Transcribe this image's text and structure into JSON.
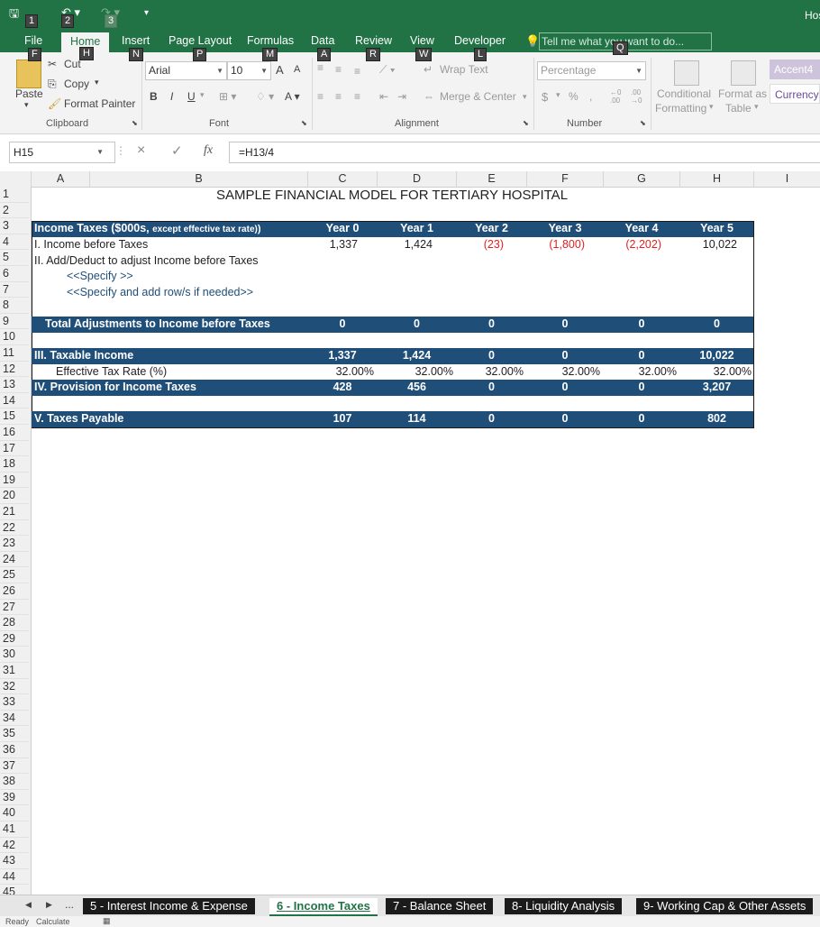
{
  "title_bar": {
    "app_title_partial": "Hos",
    "qa_keytips": [
      "1",
      "2",
      "3"
    ]
  },
  "menu": {
    "items": [
      {
        "label": "File",
        "keytip": "F"
      },
      {
        "label": "Home",
        "keytip": "H"
      },
      {
        "label": "Insert",
        "keytip": "N"
      },
      {
        "label": "Page Layout",
        "keytip": "P"
      },
      {
        "label": "Formulas",
        "keytip": "M"
      },
      {
        "label": "Data",
        "keytip": "A"
      },
      {
        "label": "Review",
        "keytip": "R"
      },
      {
        "label": "View",
        "keytip": "W"
      },
      {
        "label": "Developer",
        "keytip": "L"
      }
    ],
    "tell_me": "Tell me what you want to do...",
    "tell_me_keytip": "Q"
  },
  "ribbon": {
    "clipboard": {
      "paste": "Paste",
      "cut": "Cut",
      "copy": "Copy",
      "format_painter": "Format Painter",
      "label": "Clipboard"
    },
    "font": {
      "name": "Arial",
      "size": "10",
      "grow": "A",
      "shrink": "A",
      "bold": "B",
      "italic": "I",
      "underline": "U",
      "label": "Font"
    },
    "alignment": {
      "wrap_text": "Wrap Text",
      "merge_center": "Merge & Center",
      "label": "Alignment"
    },
    "number": {
      "format": "Percentage",
      "currency_symbol": "$",
      "percent": "%",
      "comma": ",",
      "label": "Number"
    },
    "styles": {
      "conditional_formatting_1": "Conditional",
      "conditional_formatting_2": "Formatting",
      "format_as_table_1": "Format as",
      "format_as_table_2": "Table",
      "style1": "Accent4",
      "style2": "Currency"
    }
  },
  "formula_bar": {
    "name_box": "H15",
    "formula": "=H13/4",
    "fx": "fx",
    "cancel": "×",
    "enter": "✓"
  },
  "columns": [
    "A",
    "B",
    "C",
    "D",
    "E",
    "F",
    "G",
    "H",
    "I"
  ],
  "rows": [
    "1",
    "2",
    "3",
    "4",
    "5",
    "6",
    "7",
    "8",
    "9",
    "10",
    "11",
    "12",
    "13",
    "14",
    "15",
    "16",
    "17",
    "18",
    "19",
    "20",
    "21",
    "22",
    "23",
    "24",
    "25",
    "26",
    "27",
    "28",
    "29",
    "30",
    "31",
    "32",
    "33",
    "34",
    "35",
    "36",
    "37",
    "38",
    "39",
    "40",
    "41",
    "42",
    "43",
    "44",
    "45"
  ],
  "sheet": {
    "title": "SAMPLE FINANCIAL MODEL FOR TERTIARY HOSPITAL",
    "header_label": "Income Taxes ($000s,",
    "header_label_small": "except effective tax rate)",
    "years": [
      "Year 0",
      "Year 1",
      "Year 2",
      "Year 3",
      "Year 4",
      "Year 5"
    ],
    "r4": {
      "label": "I.  Income before Taxes",
      "values": [
        "1,337",
        "1,424",
        "(23)",
        "(1,800)",
        "(2,202)",
        "10,022"
      ]
    },
    "r5": {
      "label": "II. Add/Deduct to adjust Income before Taxes"
    },
    "r6": {
      "label": "<<Specify >>"
    },
    "r7": {
      "label": "<<Specify and add row/s if needed>>"
    },
    "r9": {
      "label": "Total Adjustments to Income before Taxes",
      "values": [
        "0",
        "0",
        "0",
        "0",
        "0",
        "0"
      ]
    },
    "r11": {
      "label": "III.  Taxable Income",
      "values": [
        "1,337",
        "1,424",
        "0",
        "0",
        "0",
        "10,022"
      ]
    },
    "r12": {
      "label": "Effective Tax Rate (%)",
      "values": [
        "32.00%",
        "32.00%",
        "32.00%",
        "32.00%",
        "32.00%",
        "32.00%"
      ]
    },
    "r13": {
      "label": "IV.  Provision for Income Taxes",
      "values": [
        "428",
        "456",
        "0",
        "0",
        "0",
        "3,207"
      ]
    },
    "r15": {
      "label": "V. Taxes Payable",
      "values": [
        "107",
        "114",
        "0",
        "0",
        "0",
        "802"
      ]
    }
  },
  "tabs": {
    "nav": [
      "◀",
      "▶",
      "..."
    ],
    "items": [
      "5 - Interest Income & Expense",
      "6 - Income Taxes",
      "7 - Balance Sheet",
      "8- Liquidity Analysis",
      "9- Working Cap & Other Assets"
    ]
  },
  "status": {
    "ready": "Ready",
    "calculate": "Calculate"
  },
  "colors": {
    "excel_green": "#217346",
    "band_navy": "#1f4e79",
    "negative_red": "#e02020"
  }
}
